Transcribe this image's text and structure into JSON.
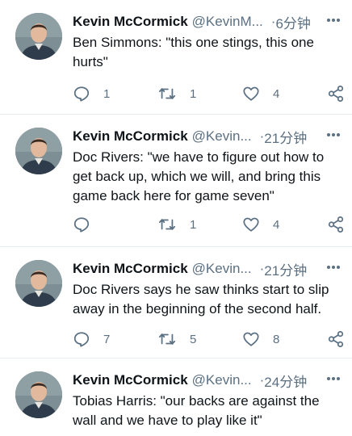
{
  "tweets": [
    {
      "name": "Kevin McCormick",
      "handle": "@KevinM...",
      "time": "6分钟",
      "text": "Ben Simmons: \"this one stings, this one hurts\"",
      "replies": "1",
      "retweets": "1",
      "likes": "4"
    },
    {
      "name": "Kevin McCormick",
      "handle": "@Kevin...",
      "time": "21分钟",
      "text": "Doc Rivers: \"we have to figure out how to get back up, which we will, and bring this game back here for game seven\"",
      "replies": "",
      "retweets": "1",
      "likes": "4"
    },
    {
      "name": "Kevin McCormick",
      "handle": "@Kevin...",
      "time": "21分钟",
      "text": "Doc Rivers says he saw thinks start to slip away in the beginning of the second half.",
      "replies": "7",
      "retweets": "5",
      "likes": "8"
    },
    {
      "name": "Kevin McCormick",
      "handle": "@Kevin...",
      "time": "24分钟",
      "text": "Tobias Harris: \"our backs are against the wall and we have to play like it\"",
      "replies": "",
      "retweets": "",
      "likes": ""
    }
  ],
  "separator": "·",
  "icons": {
    "reply": "reply-icon",
    "retweet": "retweet-icon",
    "like": "heart-icon",
    "share": "share-icon",
    "more": "more-icon"
  },
  "colors": {
    "muted": "#5b7083",
    "divider": "#e6ecf0"
  }
}
